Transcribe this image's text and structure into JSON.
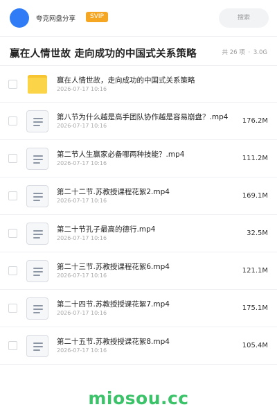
{
  "header": {
    "share_name": "夸克网盘分享",
    "badge": "SVIP",
    "search_label": "搜索",
    "avatar_color": "#2f7cf6",
    "badge_color": "#f5a623"
  },
  "title": {
    "text": "赢在人情世故 走向成功的中国式关系策略",
    "count": "共 26 项",
    "sep": "·",
    "total_size": "3.0G"
  },
  "files": [
    {
      "icon": "folder-icon",
      "name": "赢在人情世故，走向成功的中国式关系策略",
      "date": "2026-07-17 10:16",
      "size": ""
    },
    {
      "icon": "document-icon",
      "name": "第八节为什么越是高手团队协作越是容易崩盘？.mp4",
      "date": "2026-07-17 10:16",
      "size": "176.2M"
    },
    {
      "icon": "document-icon",
      "name": "第二节人生赢家必备哪两种技能？.mp4",
      "date": "2026-07-17 10:16",
      "size": "111.2M"
    },
    {
      "icon": "document-icon",
      "name": "第二十二节.苏教授课程花絮2.mp4",
      "date": "2026-07-17 10:16",
      "size": "169.1M"
    },
    {
      "icon": "document-icon",
      "name": "第二十节孔子最高的德行.mp4",
      "date": "2026-07-17 10:16",
      "size": "32.5M"
    },
    {
      "icon": "document-icon",
      "name": "第二十三节.苏教授课程花絮6.mp4",
      "date": "2026-07-17 10:16",
      "size": "121.1M"
    },
    {
      "icon": "document-icon",
      "name": "第二十四节.苏教授授课花絮7.mp4",
      "date": "2026-07-17 10:16",
      "size": "175.1M"
    },
    {
      "icon": "document-icon",
      "name": "第二十五节.苏教授授课花絮8.mp4",
      "date": "2026-07-17 10:16",
      "size": "105.4M"
    }
  ],
  "watermark": {
    "text": "miosou.cc",
    "color": "#3cc36a"
  }
}
